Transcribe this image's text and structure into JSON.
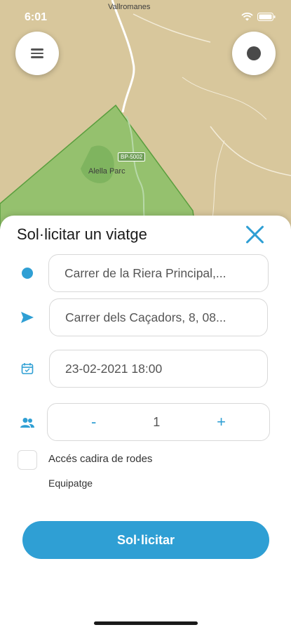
{
  "status_bar": {
    "time": "6:01"
  },
  "map": {
    "town_label": "Vallromanes",
    "place_label": "Alella Parc",
    "road_tag": "BP-5002"
  },
  "sheet": {
    "title": "Sol·licitar un viatge",
    "origin_value": "Carrer de la Riera Principal,...",
    "destination_value": "Carrer dels Caçadors, 8, 08...",
    "datetime_value": "23-02-2021 18:00",
    "passengers": {
      "minus": "-",
      "value": "1",
      "plus": "+"
    },
    "wheelchair_label": "Accés cadira de rodes",
    "luggage_label": "Equipatge",
    "submit_label": "Sol·licitar"
  },
  "colors": {
    "accent": "#2f9fd4",
    "map_bg": "#d8c79c",
    "zone": "#7fbf5f"
  }
}
